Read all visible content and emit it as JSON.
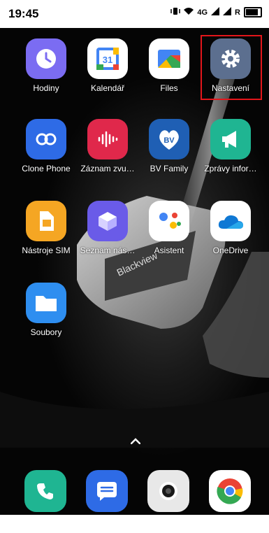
{
  "status_bar": {
    "time": "19:45",
    "network": "4G",
    "roaming": "R"
  },
  "apps": [
    {
      "label": "Hodiny",
      "icon": "clock-icon",
      "color": "#7b6cf2"
    },
    {
      "label": "Kalendář",
      "icon": "calendar-icon",
      "color": "#ffffff",
      "badge": "31"
    },
    {
      "label": "Files",
      "icon": "files-icon",
      "color": "#ffffff"
    },
    {
      "label": "Nastavení",
      "icon": "gear-icon",
      "color": "#5c6f8f"
    },
    {
      "label": "Clone Phone",
      "icon": "clone-phone-icon",
      "color": "#2e6be6"
    },
    {
      "label": "Záznam zvu…",
      "icon": "sound-recorder-icon",
      "color": "#e0284b"
    },
    {
      "label": "BV Family",
      "icon": "bv-family-icon",
      "color": "#1f5fb4",
      "badge": "BV"
    },
    {
      "label": "Zprávy infor…",
      "icon": "megaphone-icon",
      "color": "#1fb592"
    },
    {
      "label": "Nástroje SIM",
      "icon": "sim-card-icon",
      "color": "#f5a623"
    },
    {
      "label": "Seznam nás…",
      "icon": "cube-icon",
      "color": "#6a5be8"
    },
    {
      "label": "Asistent",
      "icon": "google-assistant-icon",
      "color": "#ffffff"
    },
    {
      "label": "OneDrive",
      "icon": "onedrive-icon",
      "color": "#ffffff"
    },
    {
      "label": "Soubory",
      "icon": "folder-icon",
      "color": "#2e8ef0"
    }
  ],
  "dock": [
    {
      "icon": "phone-icon",
      "color": "#1fb592"
    },
    {
      "icon": "messages-icon",
      "color": "#2e6be6"
    },
    {
      "icon": "camera-icon",
      "color": "#e8e8e8"
    },
    {
      "icon": "chrome-icon",
      "color": "#ffffff"
    }
  ],
  "wallpaper_brand": "Blackview"
}
